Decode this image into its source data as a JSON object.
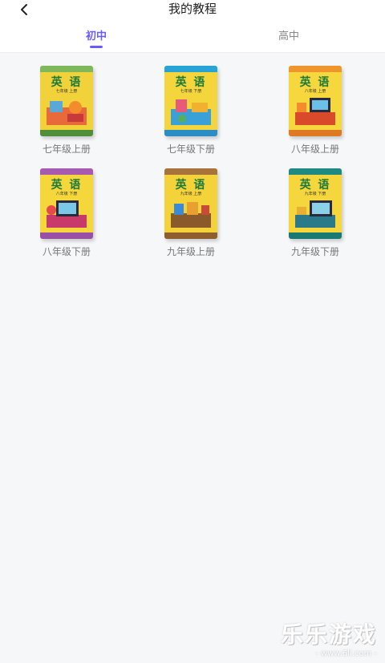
{
  "header": {
    "title": "我的教程"
  },
  "tabs": [
    {
      "label": "初中",
      "active": true
    },
    {
      "label": "高中",
      "active": false
    }
  ],
  "books": [
    {
      "label": "七年级上册",
      "title": "英 语",
      "subtitle": "七年级 上册",
      "cover_color": "#f2d23a",
      "band_color": "#7fb85a",
      "foot_color": "#4f8f3a"
    },
    {
      "label": "七年级下册",
      "title": "英 语",
      "subtitle": "七年级 下册",
      "cover_color": "#f4d63c",
      "band_color": "#27a3d6",
      "foot_color": "#2a8ec4"
    },
    {
      "label": "八年级上册",
      "title": "英 语",
      "subtitle": "八年级 上册",
      "cover_color": "#f6d83e",
      "band_color": "#f0952c",
      "foot_color": "#e07a22"
    },
    {
      "label": "八年级下册",
      "title": "英 语",
      "subtitle": "八年级 下册",
      "cover_color": "#f5d73c",
      "band_color": "#a65ab0",
      "foot_color": "#9a4fa6"
    },
    {
      "label": "九年级上册",
      "title": "英 语",
      "subtitle": "九年级 上册",
      "cover_color": "#f3d23a",
      "band_color": "#a8733a",
      "foot_color": "#8e5e2c"
    },
    {
      "label": "九年级下册",
      "title": "英 语",
      "subtitle": "九年级 下册",
      "cover_color": "#f5d63c",
      "band_color": "#1f8a82",
      "foot_color": "#1a7a72"
    }
  ],
  "watermark": {
    "main": "乐乐游戏",
    "url": "- www.6ll.com -"
  },
  "colors": {
    "accent": "#6a5cff",
    "background": "#f6f7f9"
  }
}
